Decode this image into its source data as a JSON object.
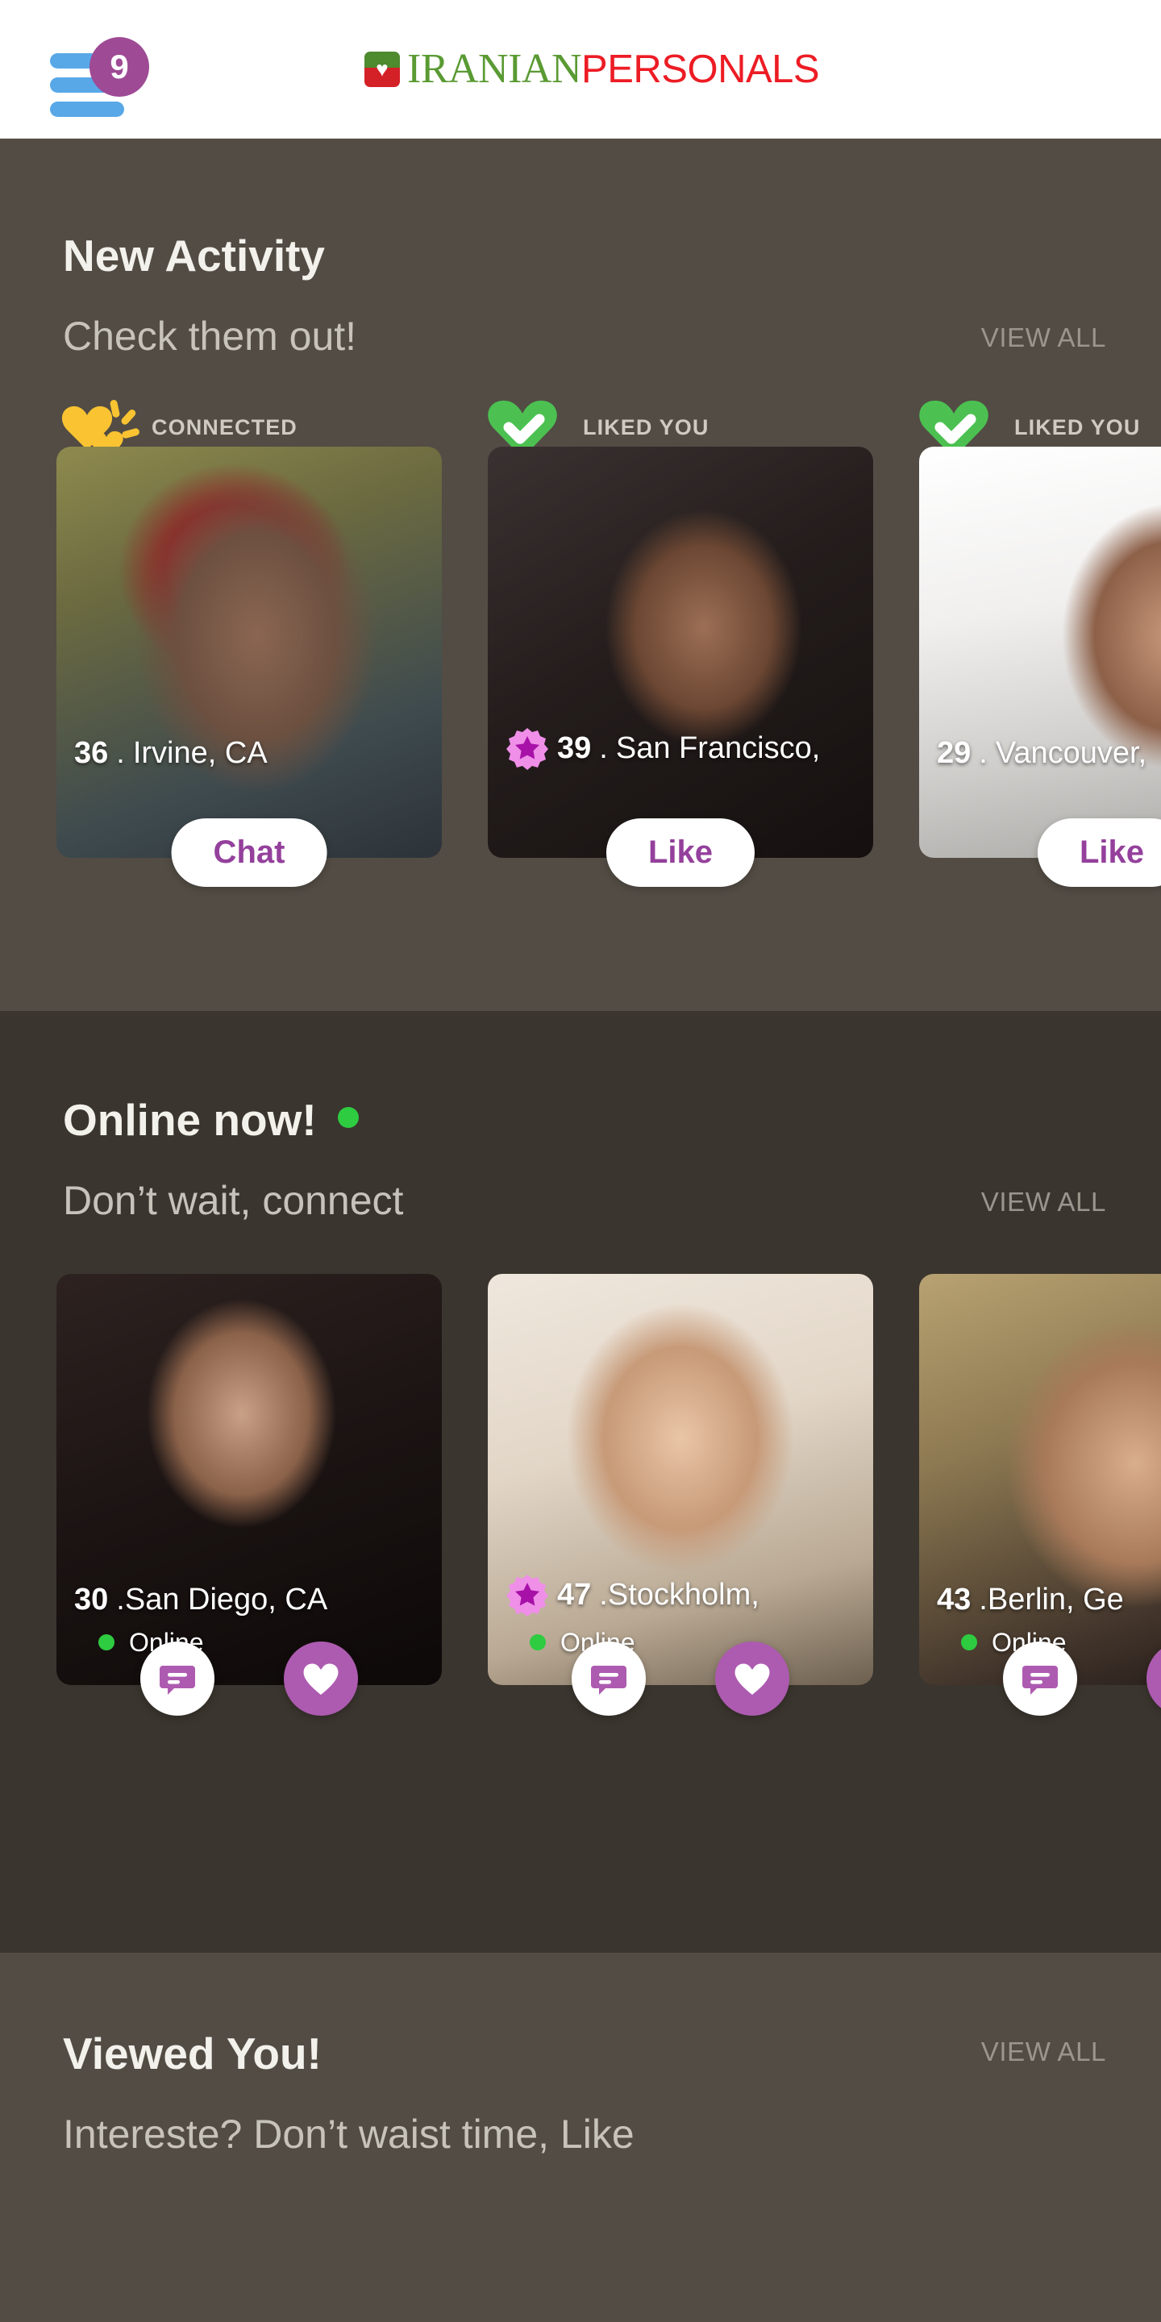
{
  "header": {
    "menu_badge_count": "9",
    "menu_icon": "hamburger-icon",
    "logo_part1": "IRANIAN",
    "logo_part2": "PERSONALS",
    "logo_mark_icon": "heart-flag-icon",
    "logo_heart_glyph": "♥"
  },
  "colors": {
    "accent_purple": "#94409c",
    "badge_purple": "#9e4a95",
    "like_purple": "#ad5bb0",
    "online_green": "#2ecc40",
    "liked_heart_green": "#4cc151",
    "connected_yellow": "#f9c331",
    "logo_green": "#5a9a33",
    "logo_red": "#ed1c24",
    "hamburger_blue": "#58a8e8",
    "section_bg_light": "#524c44",
    "section_bg_dark": "#3a352e"
  },
  "sections": [
    {
      "id": "new-activity",
      "title": "New Activity",
      "subtitle": "Check them out!",
      "view_all": "VIEW ALL",
      "cards": [
        {
          "badge_label": "CONNECTED",
          "badge_icon": "double-heart-sparkle-icon",
          "age": "36",
          "separator": ".",
          "location": "Irvine, CA",
          "has_star": false,
          "button_label": "Chat"
        },
        {
          "badge_label": "LIKED YOU",
          "badge_icon": "green-heart-check-icon",
          "age": "39",
          "separator": ".",
          "location": "San Francisco,",
          "has_star": true,
          "button_label": "Like"
        },
        {
          "badge_label": "LIKED YOU",
          "badge_icon": "green-heart-check-icon",
          "age": "29",
          "separator": ".",
          "location": "Vancouver,",
          "has_star": false,
          "button_label": "Like"
        }
      ]
    },
    {
      "id": "online-now",
      "title": "Online now!",
      "title_dot_icon": "online-green-dot-icon",
      "subtitle": "Don’t wait, connect",
      "view_all": "VIEW ALL",
      "cards": [
        {
          "age": "30",
          "separator": ".",
          "location": "San Diego, CA",
          "status": "Online",
          "has_star": false,
          "chat_icon": "chat-bubble-icon",
          "like_icon": "heart-icon"
        },
        {
          "age": "47",
          "separator": ".",
          "location": "Stockholm,",
          "status": "Online",
          "has_star": true,
          "chat_icon": "chat-bubble-icon",
          "like_icon": "heart-icon"
        },
        {
          "age": "43",
          "separator": ".",
          "location": "Berlin, Ge",
          "status": "Online",
          "has_star": false,
          "chat_icon": "chat-bubble-icon",
          "like_icon": "heart-icon"
        }
      ]
    },
    {
      "id": "viewed-you",
      "title": "Viewed You!",
      "subtitle": "Intereste? Don’t waist time, Like",
      "view_all": "VIEW ALL"
    }
  ]
}
